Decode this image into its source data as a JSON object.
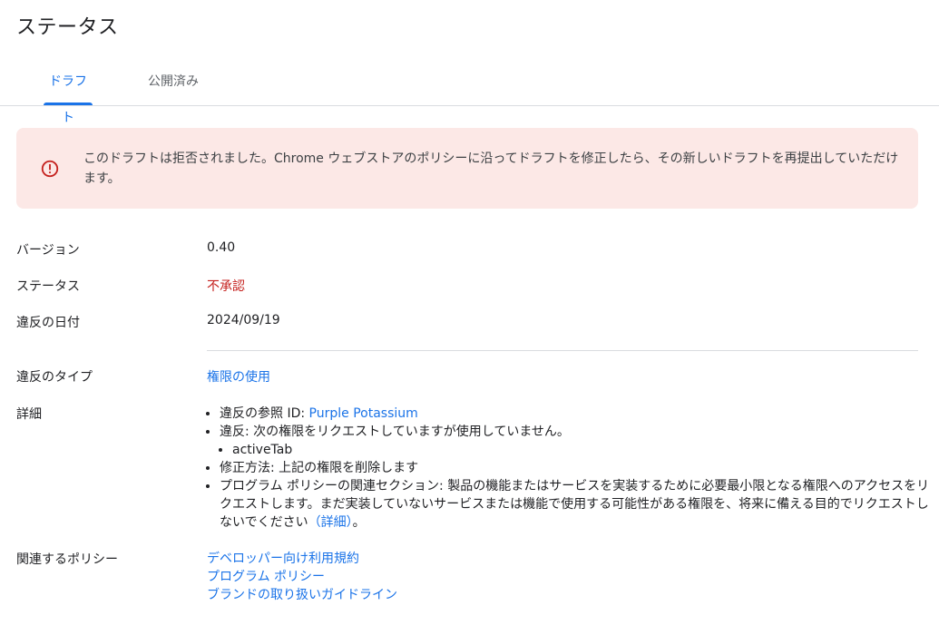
{
  "header": {
    "title": "ステータス"
  },
  "tabs": [
    {
      "label": "ドラフト",
      "active": true
    },
    {
      "label": "公開済み",
      "active": false
    }
  ],
  "alert": {
    "icon": "error-circle-icon",
    "color": "#c5221f",
    "text": "このドラフトは拒否されました。Chrome ウェブストアのポリシーに沿ってドラフトを修正したら、その新しいドラフトを再提出していただけます。"
  },
  "fields": {
    "version": {
      "label": "バージョン",
      "value": "0.40"
    },
    "status": {
      "label": "ステータス",
      "value": "不承認"
    },
    "violation_date": {
      "label": "違反の日付",
      "value": "2024/09/19"
    },
    "violation_type": {
      "label": "違反のタイプ",
      "value": "権限の使用"
    },
    "details": {
      "label": "詳細",
      "ref_prefix": "違反の参照 ID: ",
      "ref_id": "Purple Potassium",
      "violation": "違反: 次の権限をリクエストしていますが使用していません。",
      "permission": "activeTab",
      "fix": "修正方法: 上記の権限を削除します",
      "policy_text": "プログラム ポリシーの関連セクション: 製品の機能またはサービスを実装するために必要最小限となる権限へのアクセスをリクエストします。まだ実装していないサービスまたは機能で使用する可能性がある権限を、将来に備える目的でリクエストしないでください",
      "more_link": "（詳細）",
      "end": "。"
    },
    "related_policies": {
      "label": "関連するポリシー",
      "links": [
        "デベロッパー向け利用規約",
        "プログラム ポリシー",
        "ブランドの取り扱いガイドライン"
      ]
    }
  }
}
